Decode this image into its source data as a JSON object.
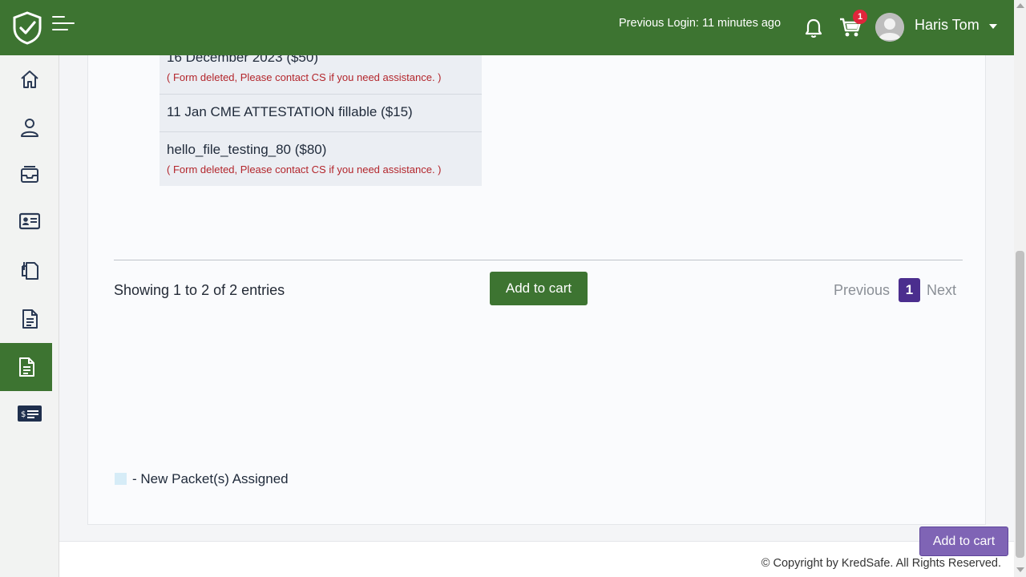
{
  "header": {
    "previous_login": "Previous Login: 11 minutes ago",
    "cart_count": "1",
    "user_name": "Haris Tom",
    "icons": [
      "shield-check-logo",
      "hamburger-menu-icon",
      "bell-icon",
      "cart-icon",
      "avatar-icon",
      "caret-down-icon"
    ]
  },
  "sidebar": {
    "items": [
      {
        "icon": "home-icon",
        "active": false
      },
      {
        "icon": "user-icon",
        "active": false
      },
      {
        "icon": "inbox-icon",
        "active": false
      },
      {
        "icon": "id-card-icon",
        "active": false
      },
      {
        "icon": "documents-icon",
        "active": false
      },
      {
        "icon": "file-text-icon",
        "active": false
      },
      {
        "icon": "file-text-icon",
        "active": true
      },
      {
        "icon": "payment-card-icon",
        "active": false
      }
    ]
  },
  "forms": [
    {
      "name": "16 December 2023 ($50)",
      "note": "( Form deleted, Please contact CS if you need assistance. )"
    },
    {
      "name": "11 Jan CME ATTESTATION fillable ($15)",
      "note": ""
    },
    {
      "name": "hello_file_testing_80 ($80)",
      "note": "( Form deleted, Please contact CS if you need assistance. )"
    }
  ],
  "table_footer": {
    "showing": "Showing 1 to 2 of 2 entries",
    "add_to_cart": "Add to cart",
    "previous": "Previous",
    "current_page": "1",
    "next": "Next"
  },
  "legend": {
    "text": "- New Packet(s) Assigned",
    "swatch_color": "#d6ecf7"
  },
  "footer": {
    "copyright": "© Copyright by KredSafe. All Rights Reserved."
  },
  "floating_button": {
    "label": "Add to cart"
  },
  "colors": {
    "brand_green": "#3d7431",
    "pagination_active": "#4b2e8e",
    "floating_button": "#7f64b5",
    "error_text": "#b3262c",
    "badge": "#e0253b"
  }
}
